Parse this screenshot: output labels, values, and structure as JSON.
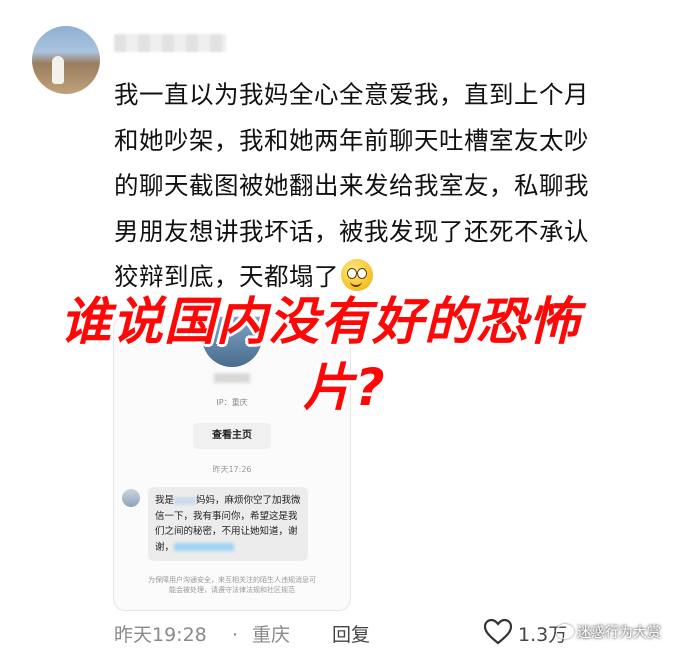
{
  "post": {
    "text": "我一直以为我妈全心全意爱我，直到上个月\n和她吵架，我和她两年前聊天吐槽室友太吵\n的聊天截图被她翻出来发给我室友，私聊我\n男朋友想讲我坏话，被我发现了还死不承认\n狡辩到底，天都塌了",
    "emoji": "smiling-face-emoji"
  },
  "screenshot_card": {
    "ip": "IP：重庆",
    "view_home": "查看主页",
    "time": "昨天17:26",
    "message_1": "我是",
    "message_2": "妈妈，麻烦你空了加我微信一下，我有事问你，希望这是我们之间的秘密，不用让她知道，谢谢，",
    "notice": "为保障用户沟通安全，来互相关注的陌生人违规消息可能会被处理，请遵守法律法规和社区规范"
  },
  "overlay": {
    "line1": "谁说国内没有好的恐怖",
    "line2": "片?"
  },
  "footer": {
    "time": "昨天19:28",
    "dot": "·",
    "location": "重庆",
    "reply": "回复",
    "likes": "1.3万"
  },
  "watermark": "迷惑行为大赏",
  "colors": {
    "overlay": "#ff0707",
    "meta": "#8a8a8a"
  }
}
